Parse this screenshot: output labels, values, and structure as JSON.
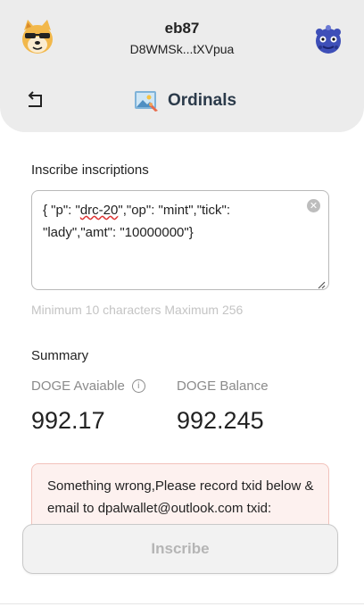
{
  "header": {
    "account_name": "eb87",
    "account_address": "D8WMSk...tXVpua",
    "title": "Ordinals",
    "icons": {
      "left_avatar": "doge-avatar-icon",
      "right_avatar": "blue-creature-avatar-icon",
      "back": "back-arrow-icon",
      "title": "ordinals-image-icon"
    }
  },
  "inscribe": {
    "label": "Inscribe inscriptions",
    "value_pre": "{ \"p\": \"",
    "value_underlined": "drc-20",
    "value_post": "\",\"op\": \"mint\",\"tick\": \"lady\",\"amt\": \"10000000\"}",
    "hint": "Minimum 10 characters Maximum 256"
  },
  "summary": {
    "label": "Summary",
    "available_label": "DOGE Avaiable",
    "available_value": "992.17",
    "balance_label": "DOGE Balance",
    "balance_value": "992.245"
  },
  "error": {
    "text": "Something wrong,Please record txid below & email to dpalwallet@outlook.com txid:"
  },
  "actions": {
    "inscribe_label": "Inscribe"
  },
  "colors": {
    "header_bg": "#ececec",
    "error_bg": "#fdf1ef",
    "error_border": "#f2c2bb",
    "title_color": "#2b3a4a",
    "muted": "#8b8b8b"
  }
}
